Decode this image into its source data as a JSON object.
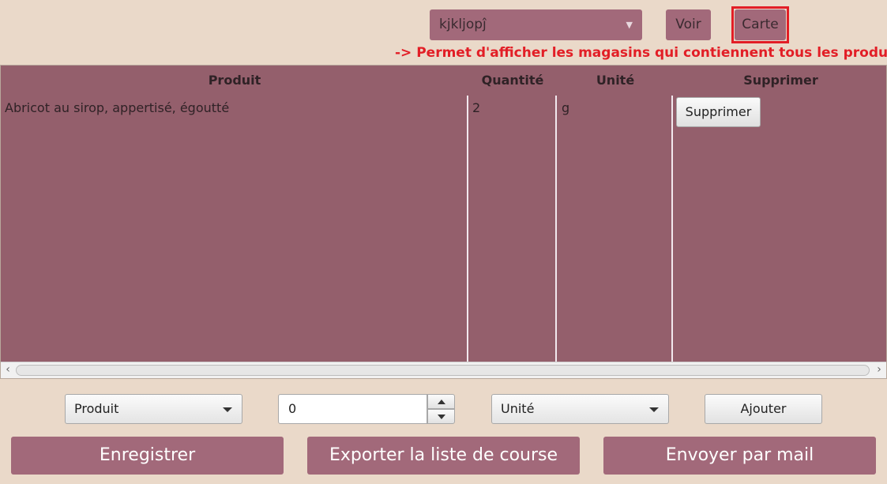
{
  "header": {
    "list_selector": {
      "value": "kjkljopĵ"
    },
    "voir_label": "Voir",
    "carte_label": "Carte",
    "annotation": "-> Permet d'afficher les magasins qui contiennent tous les produits",
    "highlight_color": "#e21e26"
  },
  "table": {
    "columns": [
      "Produit",
      "Quantité",
      "Unité",
      "Supprimer"
    ],
    "rows": [
      {
        "produit": "Abricot au sirop, appertisé, égoutté",
        "quantite": "2",
        "unite": "g",
        "supprimer_label": "Supprimer"
      }
    ]
  },
  "add_form": {
    "produit_select": "Produit",
    "quantity_value": "0",
    "unite_select": "Unité",
    "ajouter_label": "Ajouter"
  },
  "footer": {
    "save_label": "Enregistrer",
    "export_label": "Exporter la liste de course",
    "mail_label": "Envoyer par mail"
  },
  "colors": {
    "background": "#ead9c9",
    "accent": "#a2697a",
    "table_bg": "#945f6c"
  }
}
